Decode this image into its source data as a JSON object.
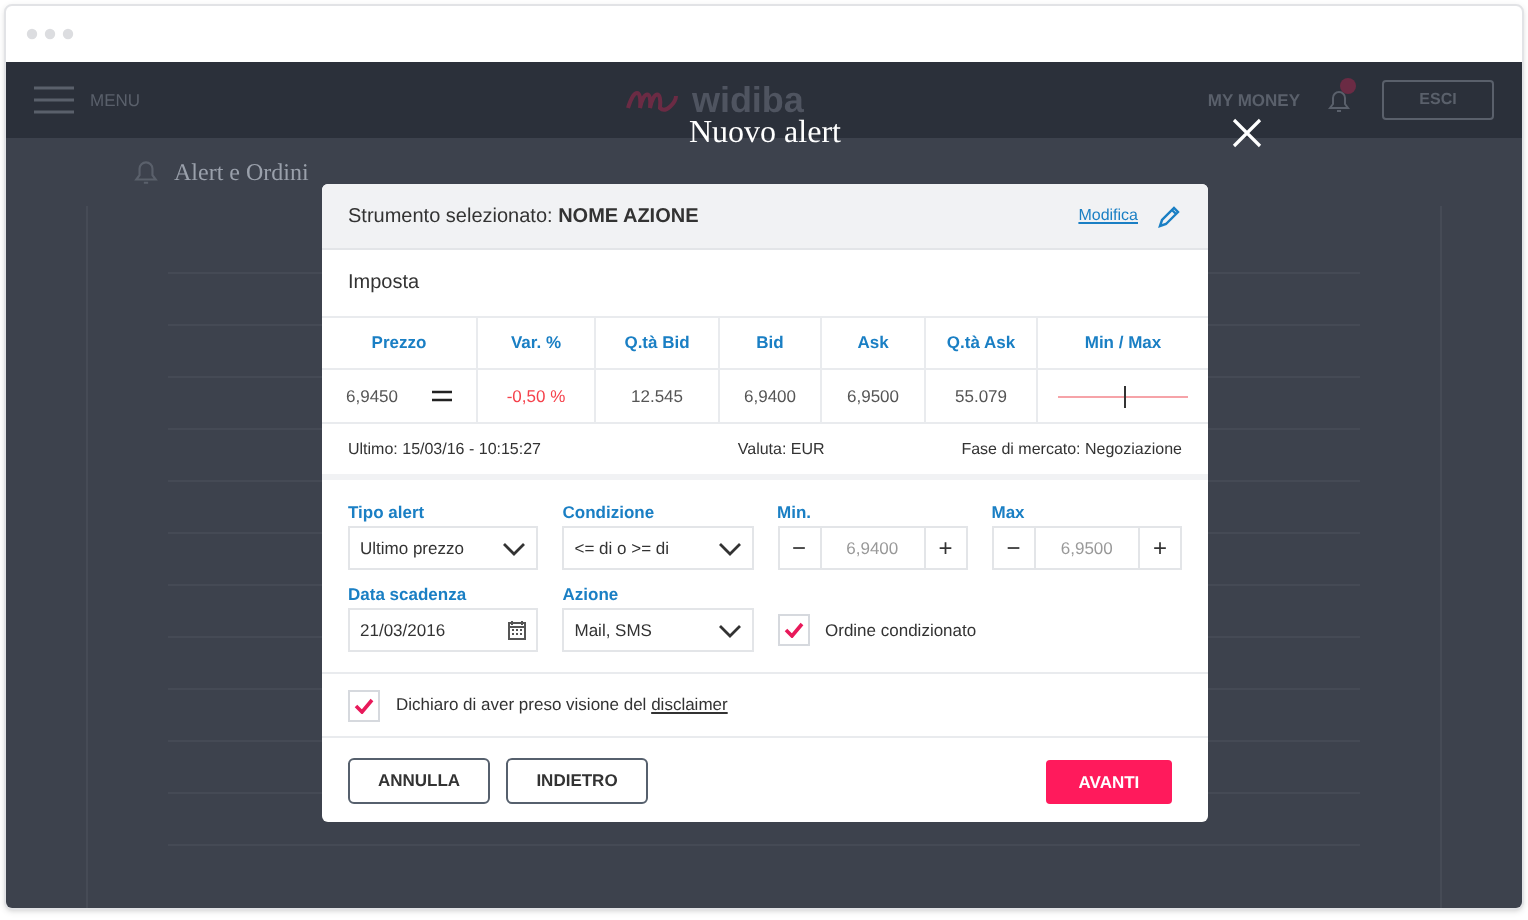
{
  "header": {
    "menu_label": "MENU",
    "logo_text": "widiba",
    "my_money": "MY MONEY",
    "logout_button": "ESCI"
  },
  "page_title": "Alert e Ordini",
  "modal": {
    "title": "Nuovo alert",
    "instrument": {
      "label": "Strumento selezionato:",
      "name": "NOME AZIONE",
      "edit_link": "Modifica"
    },
    "section_title": "Imposta",
    "quote_table": {
      "columns": [
        "Prezzo",
        "Var. %",
        "Q.tà Bid",
        "Bid",
        "Ask",
        "Q.tà Ask",
        "Min / Max"
      ],
      "cells": [
        {
          "kind": "price",
          "text": "6,9450"
        },
        {
          "kind": "change",
          "text": "-0,50 %",
          "negative": true
        },
        {
          "kind": "plain",
          "text": "12.545"
        },
        {
          "kind": "plain",
          "text": "6,9400"
        },
        {
          "kind": "plain",
          "text": "6,9500"
        },
        {
          "kind": "plain",
          "text": "55.079"
        },
        {
          "kind": "range",
          "level": 0.5
        }
      ]
    },
    "info": {
      "last": "Ultimo: 15/03/16 - 10:15:27",
      "currency": "Valuta: EUR",
      "market_phase": "Fase di mercato: Negoziazione"
    },
    "fields": [
      {
        "kind": "select",
        "label": "Tipo alert",
        "value": "Ultimo prezzo"
      },
      {
        "kind": "select",
        "label": "Condizione",
        "value": "<= di o >= di"
      },
      {
        "kind": "stepper",
        "label": "Min.",
        "placeholder": "6,9400",
        "minus": "−",
        "plus": "+"
      },
      {
        "kind": "stepper",
        "label": "Max",
        "placeholder": "6,9500",
        "minus": "−",
        "plus": "+"
      },
      {
        "kind": "date",
        "label": "Data scadenza",
        "value": "21/03/2016"
      },
      {
        "kind": "select",
        "label": "Azione",
        "value": "Mail, SMS"
      },
      {
        "kind": "checkbox",
        "label": "Ordine condizionato",
        "checked": true
      }
    ],
    "disclaimer": {
      "text": "Dichiaro di aver preso visione del",
      "link": "disclaimer",
      "checked": true
    },
    "buttons": [
      {
        "kind": "outline",
        "label": "ANNULLA"
      },
      {
        "kind": "outline",
        "label": "INDIETRO"
      },
      {
        "kind": "primary",
        "label": "AVANTI"
      }
    ]
  }
}
